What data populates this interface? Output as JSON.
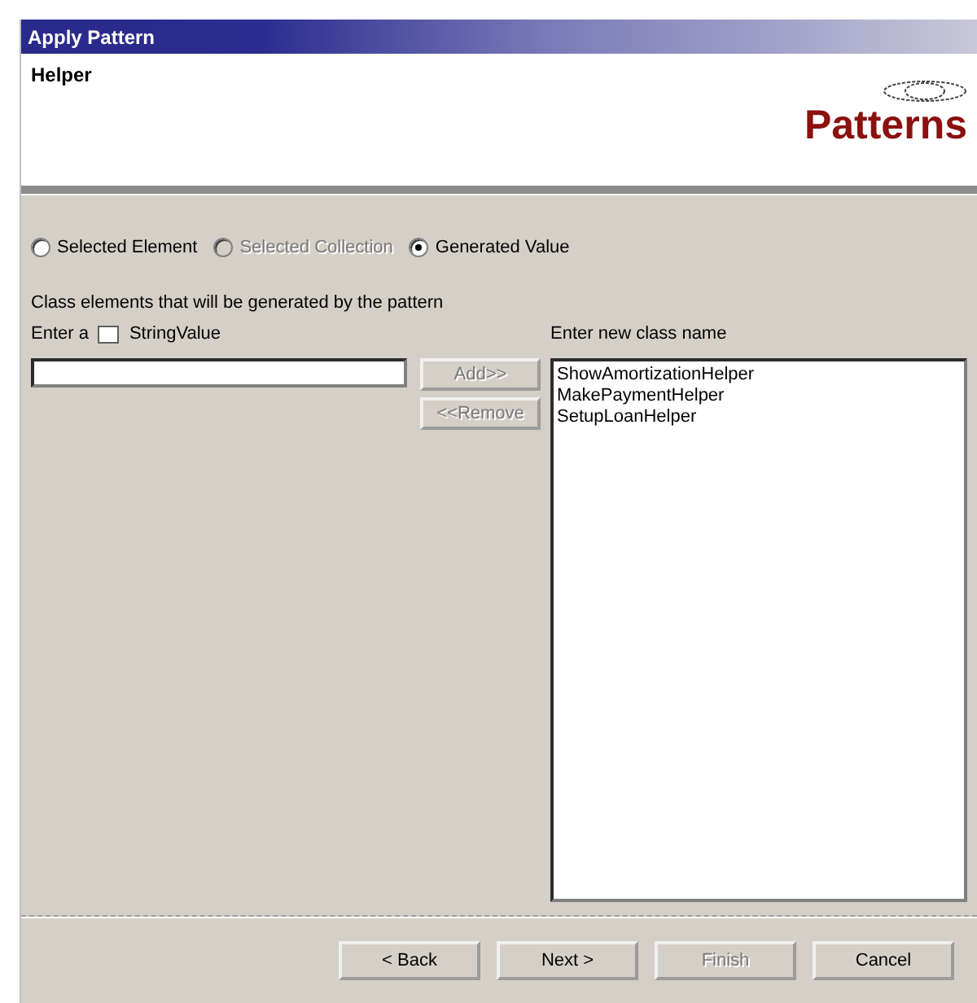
{
  "window": {
    "title": "Apply Pattern"
  },
  "header": {
    "subtitle": "Helper",
    "logo_text": "Patterns"
  },
  "source_options": [
    {
      "label": "Selected Element",
      "selected": false,
      "disabled": false
    },
    {
      "label": "Selected Collection",
      "selected": false,
      "disabled": true
    },
    {
      "label": "Generated Value",
      "selected": true,
      "disabled": false
    }
  ],
  "description": "Class elements that will be generated by the pattern",
  "value_prompt": {
    "prefix": "Enter a",
    "type_label": "StringValue"
  },
  "list_buttons": [
    {
      "label": "Add>>",
      "disabled": true
    },
    {
      "label": "<<Remove",
      "disabled": true
    }
  ],
  "class_list": {
    "label": "Enter new class name",
    "items": [
      "ShowAmortizationHelper",
      "MakePaymentHelper",
      "SetupLoanHelper"
    ]
  },
  "buttons": [
    {
      "label": "< Back",
      "disabled": false
    },
    {
      "label": "Next >",
      "disabled": false
    },
    {
      "label": "Finish",
      "disabled": true
    },
    {
      "label": "Cancel",
      "disabled": false
    }
  ]
}
